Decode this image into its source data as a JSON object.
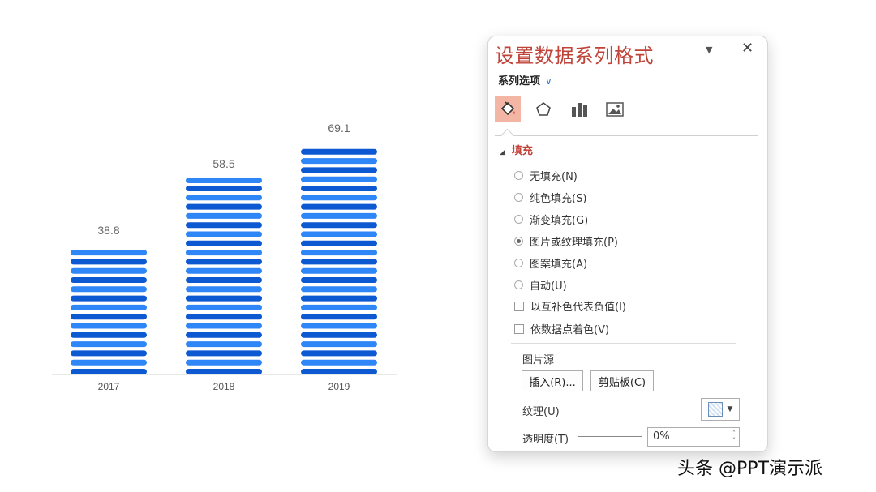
{
  "chart_data": {
    "type": "bar",
    "categories": [
      "2017",
      "2018",
      "2019"
    ],
    "values": [
      38.8,
      58.5,
      69.1
    ],
    "data_labels": [
      "38.8",
      "58.5",
      "69.1"
    ],
    "fill": "picture-stacked-stripes",
    "colors": {
      "bar_top": "#2f86f6",
      "bar_bottom": "#0c59d2",
      "label": "#666666",
      "axis": "#d0d0d0"
    },
    "ylim": [
      0,
      75
    ],
    "grid": false,
    "legend": "none"
  },
  "pane": {
    "title": "设置数据系列格式",
    "series_options": "系列选项",
    "tabs": [
      {
        "name": "fill-line",
        "icon": "paint-bucket-icon",
        "active": true
      },
      {
        "name": "effects",
        "icon": "pentagon-icon",
        "active": false
      },
      {
        "name": "series-options",
        "icon": "bar-chart-icon",
        "active": false
      },
      {
        "name": "picture",
        "icon": "image-icon",
        "active": false
      }
    ],
    "fill_section": "填充",
    "fill_options": [
      "无填充(N)",
      "纯色填充(S)",
      "渐变填充(G)",
      "图片或纹理填充(P)",
      "图案填充(A)",
      "自动(U)"
    ],
    "selected_fill": "图片或纹理填充(P)",
    "checkbox_invert": "以互补色代表负值(I)",
    "checkbox_vary": "依数据点着色(V)",
    "picture_source": "图片源",
    "insert_button": "插入(R)...",
    "clipboard_button": "剪贴板(C)",
    "texture_label": "纹理(U)",
    "transparency_label": "透明度(T)",
    "transparency_value": "0%"
  },
  "watermark": "头条 @PPT演示派"
}
